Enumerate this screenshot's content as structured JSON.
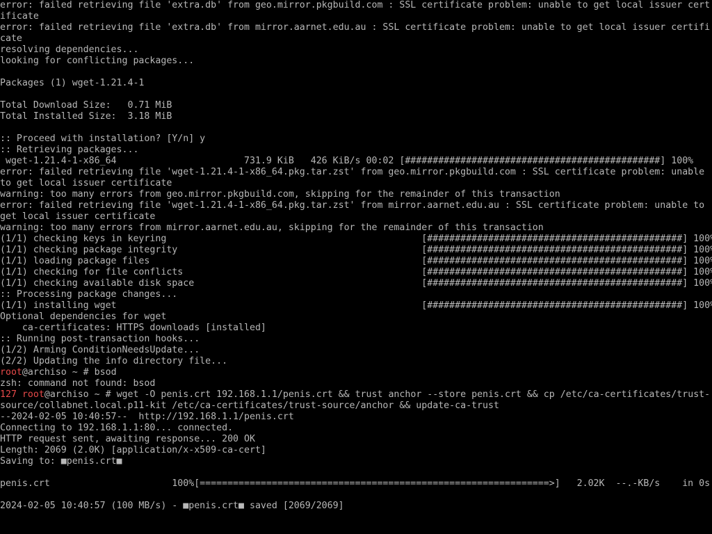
{
  "colors": {
    "background": "#000000",
    "foreground": "#b8b8b8",
    "prompt_accent": "#e84a4a"
  },
  "terminal": {
    "lines": [
      "error: failed retrieving file 'extra.db' from geo.mirror.pkgbuild.com : SSL certificate problem: unable to get local issuer cert",
      "ificate",
      "error: failed retrieving file 'extra.db' from mirror.aarnet.edu.au : SSL certificate problem: unable to get local issuer certifi",
      "cate",
      "resolving dependencies...",
      "looking for conflicting packages...",
      "",
      "Packages (1) wget-1.21.4-1",
      "",
      "Total Download Size:   0.71 MiB",
      "Total Installed Size:  3.18 MiB",
      "",
      ":: Proceed with installation? [Y/n] y",
      ":: Retrieving packages...",
      " wget-1.21.4-1-x86_64                       731.9 KiB   426 KiB/s 00:02 [##############################################] 100%",
      "error: failed retrieving file 'wget-1.21.4-1-x86_64.pkg.tar.zst' from geo.mirror.pkgbuild.com : SSL certificate problem: unable",
      "to get local issuer certificate",
      "warning: too many errors from geo.mirror.pkgbuild.com, skipping for the remainder of this transaction",
      "error: failed retrieving file 'wget-1.21.4-1-x86_64.pkg.tar.zst' from mirror.aarnet.edu.au : SSL certificate problem: unable to",
      "get local issuer certificate",
      "warning: too many errors from mirror.aarnet.edu.au, skipping for the remainder of this transaction",
      "(1/1) checking keys in keyring                                              [##############################################] 100%",
      "(1/1) checking package integrity                                            [##############################################] 100%",
      "(1/1) loading package files                                                 [##############################################] 100%",
      "(1/1) checking for file conflicts                                           [##############################################] 100%",
      "(1/1) checking available disk space                                         [##############################################] 100%",
      ":: Processing package changes...",
      "(1/1) installing wget                                                       [##############################################] 100%",
      "Optional dependencies for wget",
      "    ca-certificates: HTTPS downloads [installed]",
      ":: Running post-transaction hooks...",
      "(1/2) Arming ConditionNeedsUpdate...",
      "(2/2) Updating the info directory file...",
      "",
      "zsh: command not found: bsod",
      "",
      "source/collabnet.local.p11-kit /etc/ca-certificates/trust-source/anchor && update-ca-trust",
      "--2024-02-05 10:40:57--  http://192.168.1.1/penis.crt",
      "Connecting to 192.168.1.1:80... connected.",
      "HTTP request sent, awaiting response... 200 OK",
      "Length: 2069 (2.0K) [application/x-x509-ca-cert]",
      "Saving to: ■penis.crt■",
      "",
      "penis.crt                      100%[===============================================================>]   2.02K  --.-KB/s    in 0s",
      "",
      "2024-02-05 10:40:57 (100 MB/s) - ■penis.crt■ saved [2069/2069]"
    ],
    "prompt1": {
      "user": "root",
      "host_path": "@archiso ~ # ",
      "command": "bsod"
    },
    "prompt2": {
      "exit_code": "127",
      "user": "root",
      "host_path": "@archiso ~ # ",
      "command": "wget -O penis.crt 192.168.1.1/penis.crt && trust anchor --store penis.crt && cp /etc/ca-certificates/trust-"
    }
  }
}
